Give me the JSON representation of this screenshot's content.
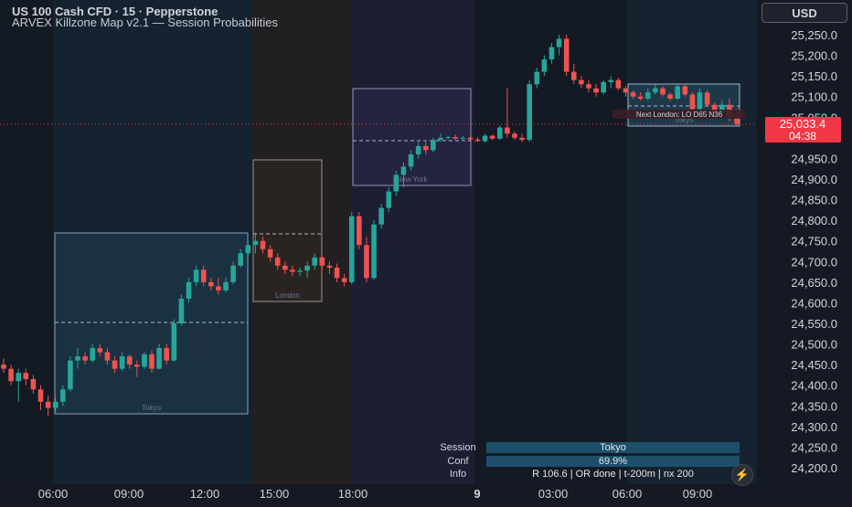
{
  "header": {
    "symbol_title": "US 100 Cash CFD · 15 · Pepperstone",
    "indicator_title": "ARVEX Killzone Map v2.1 — Session Probabilities"
  },
  "currency_button": "USD",
  "price_axis": {
    "ticks": [
      "25,250.0",
      "25,200.0",
      "25,150.0",
      "25,100.0",
      "25,050.0",
      "24,950.0",
      "24,900.0",
      "24,850.0",
      "24,800.0",
      "24,750.0",
      "24,700.0",
      "24,650.0",
      "24,600.0",
      "24,550.0",
      "24,500.0",
      "24,450.0",
      "24,400.0",
      "24,350.0",
      "24,300.0",
      "24,250.0",
      "24,200.0"
    ],
    "last_price_label": "25,033.4",
    "countdown": "04:38",
    "last_price_color": "#f23645"
  },
  "time_axis": {
    "ticks": [
      "06:00",
      "09:00",
      "12:00",
      "15:00",
      "18:00",
      "9",
      "03:00",
      "06:00",
      "09:00"
    ]
  },
  "sessions": [
    {
      "label": "Tokyo"
    },
    {
      "label": "London"
    },
    {
      "label": "New York"
    },
    {
      "label": "Tokyo"
    }
  ],
  "next_session_note": "Next London: LO D65 N36",
  "info_table": {
    "rows": [
      {
        "key": "Session",
        "value": "Tokyo"
      },
      {
        "key": "Conf",
        "value": "69.9%"
      },
      {
        "key": "Info",
        "value": "R 106.6 | OR done | t-200m | nx 200"
      }
    ]
  },
  "colors": {
    "background": "#141923",
    "bull": "#26a69a",
    "bear": "#ef5350",
    "tokyo_fill": "#1b3444",
    "london_fill": "#2a2622",
    "newyork_fill": "#262443"
  },
  "chart_data": {
    "type": "candlestick",
    "symbol": "US 100 Cash CFD",
    "timeframe": "15",
    "broker": "Pepperstone",
    "y_axis_range": [
      24180,
      25280
    ],
    "last_price": 25033.4,
    "candles_ohlc": [
      [
        24450,
        24465,
        24430,
        24440
      ],
      [
        24440,
        24450,
        24400,
        24410
      ],
      [
        24410,
        24440,
        24360,
        24430
      ],
      [
        24430,
        24440,
        24400,
        24415
      ],
      [
        24415,
        24425,
        24380,
        24390
      ],
      [
        24390,
        24400,
        24340,
        24360
      ],
      [
        24360,
        24375,
        24325,
        24345
      ],
      [
        24345,
        24370,
        24335,
        24360
      ],
      [
        24360,
        24400,
        24350,
        24390
      ],
      [
        24390,
        24470,
        24385,
        24460
      ],
      [
        24460,
        24490,
        24440,
        24470
      ],
      [
        24470,
        24480,
        24450,
        24460
      ],
      [
        24460,
        24500,
        24455,
        24490
      ],
      [
        24490,
        24500,
        24470,
        24480
      ],
      [
        24480,
        24490,
        24450,
        24460
      ],
      [
        24460,
        24470,
        24430,
        24440
      ],
      [
        24440,
        24480,
        24435,
        24470
      ],
      [
        24470,
        24475,
        24440,
        24450
      ],
      [
        24450,
        24460,
        24420,
        24445
      ],
      [
        24445,
        24480,
        24440,
        24475
      ],
      [
        24475,
        24485,
        24430,
        24440
      ],
      [
        24440,
        24500,
        24438,
        24490
      ],
      [
        24490,
        24500,
        24450,
        24460
      ],
      [
        24460,
        24560,
        24458,
        24550
      ],
      [
        24550,
        24620,
        24545,
        24610
      ],
      [
        24610,
        24660,
        24600,
        24650
      ],
      [
        24650,
        24690,
        24640,
        24680
      ],
      [
        24680,
        24690,
        24640,
        24650
      ],
      [
        24650,
        24660,
        24630,
        24640
      ],
      [
        24640,
        24660,
        24620,
        24630
      ],
      [
        24630,
        24660,
        24625,
        24650
      ],
      [
        24650,
        24700,
        24645,
        24690
      ],
      [
        24690,
        24730,
        24685,
        24720
      ],
      [
        24720,
        24750,
        24710,
        24740
      ],
      [
        24740,
        24770,
        24720,
        24750
      ],
      [
        24750,
        24760,
        24720,
        24730
      ],
      [
        24730,
        24740,
        24700,
        24710
      ],
      [
        24710,
        24720,
        24680,
        24690
      ],
      [
        24690,
        24700,
        24670,
        24680
      ],
      [
        24680,
        24690,
        24665,
        24675
      ],
      [
        24675,
        24685,
        24665,
        24678
      ],
      [
        24678,
        24700,
        24660,
        24690
      ],
      [
        24690,
        24720,
        24680,
        24710
      ],
      [
        24710,
        24715,
        24680,
        24690
      ],
      [
        24690,
        24700,
        24670,
        24685
      ],
      [
        24685,
        24695,
        24650,
        24660
      ],
      [
        24660,
        24670,
        24640,
        24650
      ],
      [
        24650,
        24820,
        24645,
        24810
      ],
      [
        24810,
        24820,
        24730,
        24740
      ],
      [
        24740,
        24760,
        24650,
        24660
      ],
      [
        24660,
        24800,
        24655,
        24790
      ],
      [
        24790,
        24840,
        24780,
        24830
      ],
      [
        24830,
        24880,
        24820,
        24870
      ],
      [
        24870,
        24920,
        24860,
        24910
      ],
      [
        24910,
        24940,
        24880,
        24930
      ],
      [
        24930,
        24970,
        24920,
        24960
      ],
      [
        24960,
        24990,
        24950,
        24980
      ],
      [
        24980,
        24990,
        24960,
        24970
      ],
      [
        24970,
        25000,
        24965,
        24995
      ],
      [
        24995,
        25010,
        24990,
        25000
      ],
      [
        25000,
        25005,
        24995,
        25002
      ],
      [
        25002,
        25008,
        24995,
        24998
      ],
      [
        24998,
        25005,
        24992,
        25000
      ],
      [
        25000,
        25004,
        24994,
        24996
      ],
      [
        24996,
        25002,
        24990,
        24992
      ],
      [
        24992,
        25010,
        24988,
        25005
      ],
      [
        25005,
        25008,
        24995,
        24998
      ],
      [
        24998,
        25030,
        24995,
        25025
      ],
      [
        25025,
        25120,
        25000,
        25010
      ],
      [
        25010,
        25015,
        24995,
        25000
      ],
      [
        25000,
        25010,
        24990,
        24995
      ],
      [
        24995,
        25140,
        24990,
        25130
      ],
      [
        25130,
        25170,
        25120,
        25160
      ],
      [
        25160,
        25200,
        25150,
        25190
      ],
      [
        25190,
        25230,
        25180,
        25220
      ],
      [
        25220,
        25250,
        25200,
        25240
      ],
      [
        25240,
        25250,
        25150,
        25160
      ],
      [
        25160,
        25180,
        25130,
        25140
      ],
      [
        25140,
        25150,
        25120,
        25130
      ],
      [
        25130,
        25140,
        25110,
        25120
      ],
      [
        25120,
        25130,
        25100,
        25110
      ],
      [
        25110,
        25140,
        25105,
        25135
      ],
      [
        25135,
        25150,
        25120,
        25140
      ],
      [
        25140,
        25145,
        25115,
        25120
      ],
      [
        25120,
        25125,
        25100,
        25110
      ],
      [
        25110,
        25115,
        25095,
        25100
      ],
      [
        25100,
        25110,
        25090,
        25095
      ],
      [
        25095,
        25120,
        25090,
        25110
      ],
      [
        25110,
        25130,
        25105,
        25120
      ],
      [
        25120,
        25125,
        25100,
        25105
      ],
      [
        25105,
        25110,
        25090,
        25095
      ],
      [
        25095,
        25130,
        25092,
        25125
      ],
      [
        25125,
        25130,
        25100,
        25105
      ],
      [
        25105,
        25110,
        25060,
        25070
      ],
      [
        25070,
        25120,
        25065,
        25110
      ],
      [
        25110,
        25115,
        25075,
        25080
      ],
      [
        25080,
        25085,
        25050,
        25060
      ],
      [
        25060,
        25090,
        25055,
        25080
      ],
      [
        25080,
        25095,
        25040,
        25050
      ],
      [
        25050,
        25070,
        25030,
        25033
      ]
    ]
  }
}
